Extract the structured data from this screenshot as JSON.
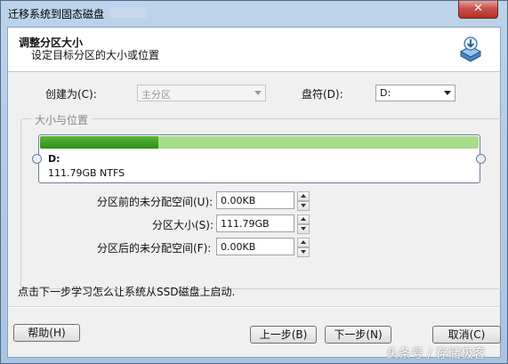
{
  "window": {
    "title": "迁移系统到固态磁盘",
    "close_label": "✕"
  },
  "header": {
    "title": "调整分区大小",
    "subtitle": "设定目标分区的大小或位置"
  },
  "form": {
    "create_as_label": "创建为(C):",
    "create_as_value": "主分区",
    "drive_letter_label": "盘符(D):",
    "drive_letter_value": "D:"
  },
  "size_group": {
    "legend": "大小与位置",
    "partition_letter": "D:",
    "partition_info": "111.79GB NTFS",
    "used_fraction": 0.27
  },
  "fields": {
    "before_label": "分区前的未分配空间(U):",
    "before_value": "0.00KB",
    "size_label": "分区大小(S):",
    "size_value": "111.79GB",
    "after_label": "分区后的未分配空间(F):",
    "after_value": "0.00KB"
  },
  "hint": "点击下一步学习怎么让系统从SSD磁盘上启动.",
  "buttons": {
    "help": "帮助(H)",
    "back": "上一步(B)",
    "next": "下一步(N)",
    "cancel": "取消(C)"
  },
  "watermark": "头条号 / 存储极客"
}
